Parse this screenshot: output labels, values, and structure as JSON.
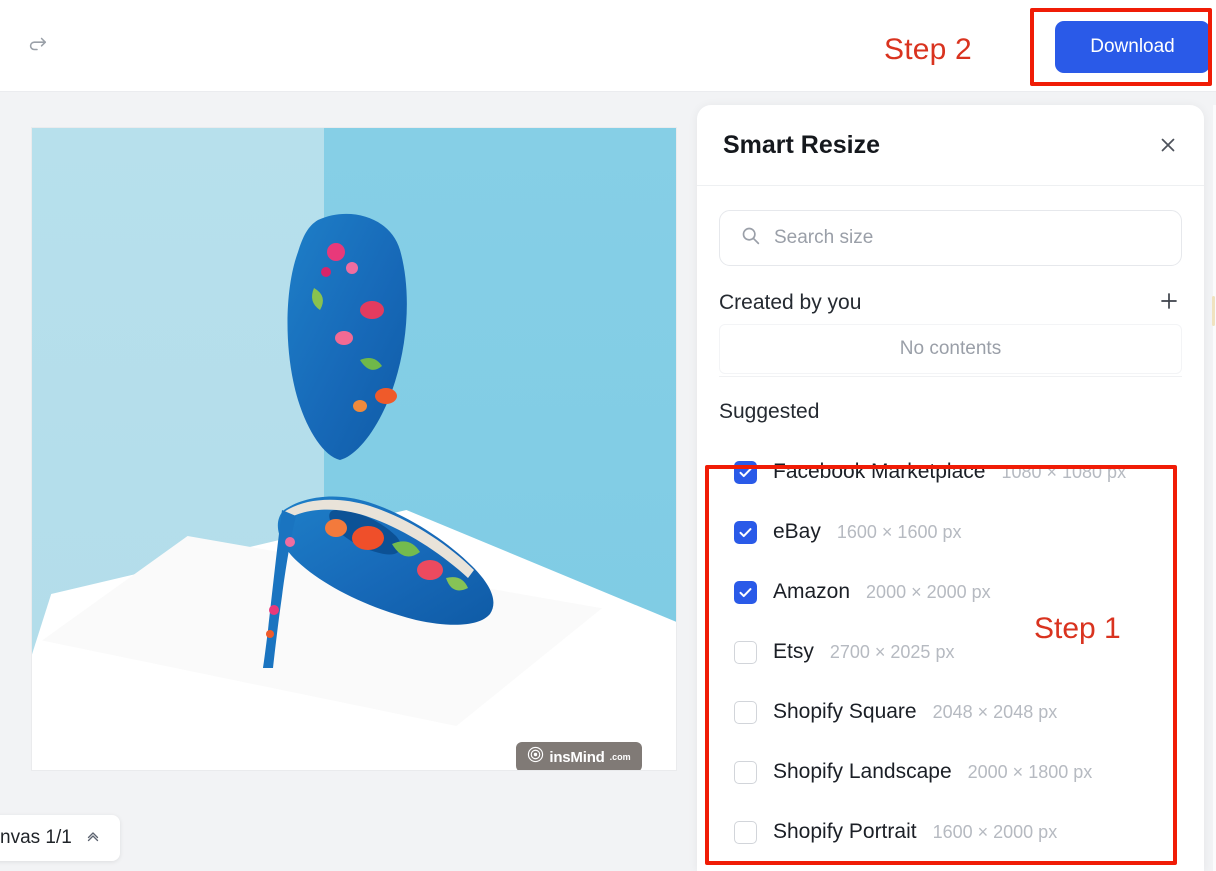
{
  "topbar": {
    "redo_icon": "redo-icon",
    "step2_label": "Step 2",
    "download_label": "Download",
    "accent_blue": "#2a5ae8",
    "annotation_red": "#f01c06"
  },
  "canvas": {
    "pill_label": "nvas 1/1",
    "pill_chevron": "chevron-up-icon",
    "watermark_text": "insMind",
    "watermark_suffix": ".com",
    "background": "#f2f3f5"
  },
  "panel": {
    "title": "Smart Resize",
    "close_icon": "close-icon",
    "search": {
      "icon": "search-icon",
      "value": "",
      "placeholder": "Search size"
    },
    "created": {
      "title": "Created by you",
      "add_icon": "plus-icon",
      "empty_text": "No contents"
    },
    "suggested": {
      "title": "Suggested",
      "items": [
        {
          "label": "Facebook Marketplace",
          "size": "1080 × 1080 px",
          "checked": true
        },
        {
          "label": "eBay",
          "size": "1600 × 1600 px",
          "checked": true
        },
        {
          "label": "Amazon",
          "size": "2000 × 2000 px",
          "checked": true
        },
        {
          "label": "Etsy",
          "size": "2700 × 2025 px",
          "checked": false
        },
        {
          "label": "Shopify Square",
          "size": "2048 × 2048 px",
          "checked": false
        },
        {
          "label": "Shopify Landscape",
          "size": "2000 × 1800 px",
          "checked": false
        },
        {
          "label": "Shopify Portrait",
          "size": "1600 × 2000 px",
          "checked": false
        }
      ]
    }
  },
  "annotations": {
    "step1_label": "Step 1"
  }
}
